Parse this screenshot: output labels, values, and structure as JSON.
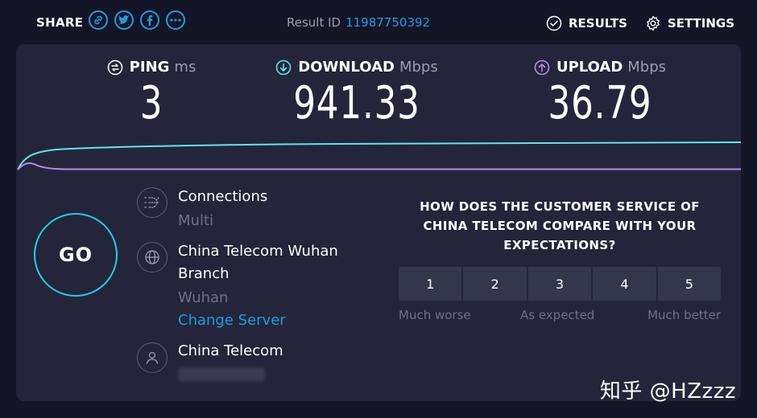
{
  "header": {
    "share_label": "SHARE",
    "share_icons": [
      "link-icon",
      "twitter-icon",
      "facebook-icon",
      "more-icon"
    ],
    "result_id_label": "Result ID",
    "result_id": "11987750392",
    "results_label": "RESULTS",
    "settings_label": "SETTINGS"
  },
  "metrics": {
    "ping": {
      "label": "PING",
      "unit": "ms",
      "value": "3"
    },
    "download": {
      "label": "DOWNLOAD",
      "unit": "Mbps",
      "value": "941.33"
    },
    "upload": {
      "label": "UPLOAD",
      "unit": "Mbps",
      "value": "36.79"
    }
  },
  "go_label": "GO",
  "connections": {
    "title": "Connections",
    "value": "Multi"
  },
  "server": {
    "name": "China Telecom Wuhan Branch",
    "location": "Wuhan",
    "change_label": "Change Server"
  },
  "isp": {
    "name": "China Telecom"
  },
  "survey": {
    "question": "HOW DOES THE CUSTOMER SERVICE OF CHINA TELECOM COMPARE WITH YOUR EXPECTATIONS?",
    "options": [
      "1",
      "2",
      "3",
      "4",
      "5"
    ],
    "low_label": "Much worse",
    "mid_label": "As expected",
    "high_label": "Much better"
  },
  "watermark": "知乎 @HZzzz",
  "colors": {
    "accent": "#1c9de0",
    "download_line": "#5ee6e6",
    "upload_line": "#b98be8",
    "background": "#141526",
    "card": "#24253a"
  }
}
